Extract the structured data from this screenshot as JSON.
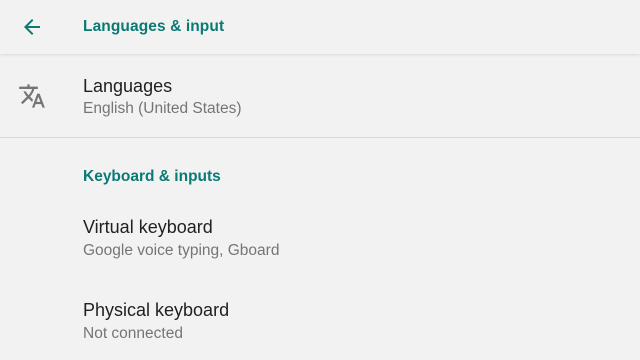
{
  "appbar": {
    "title": "Languages & input",
    "back_icon": "arrow-back-icon",
    "accent_color": "#0a7a75"
  },
  "languages": {
    "icon": "translate-icon",
    "title": "Languages",
    "summary": "English (United States)"
  },
  "keyboard_section": {
    "header": "Keyboard & inputs",
    "items": [
      {
        "title": "Virtual keyboard",
        "summary": "Google voice typing, Gboard"
      },
      {
        "title": "Physical keyboard",
        "summary": "Not connected"
      }
    ]
  }
}
